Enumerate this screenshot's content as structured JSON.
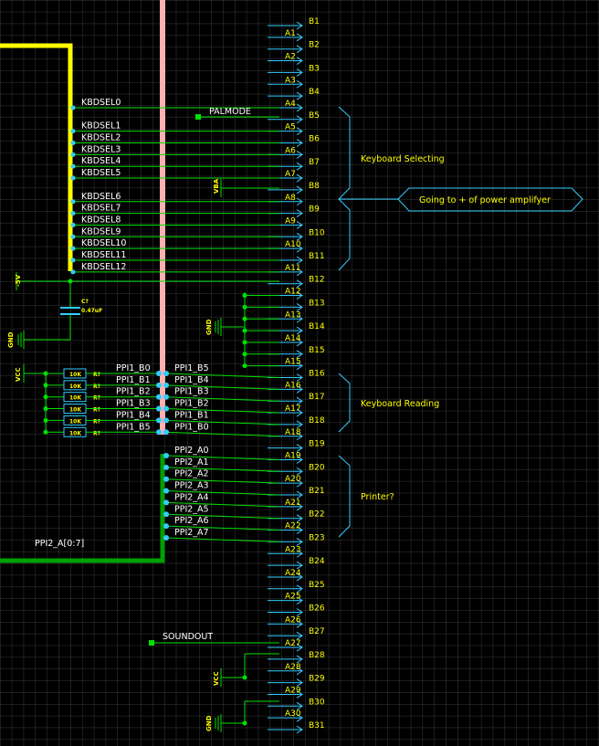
{
  "colors": {
    "background": "#000000",
    "grid": "#3a3a3a",
    "wire": "#00e000",
    "net_label": "#ffffff",
    "pin_label": "#ffff00",
    "connector": "#33ccff",
    "bus_yellow": "#ffff00",
    "bus_pink": "#ffb0b0",
    "bus_green": "#00a000",
    "junction": "#00e000",
    "power_label": "#ffff00",
    "annotation": "#ffff00"
  },
  "connector": {
    "pins": [
      "B1",
      "A1",
      "B2",
      "A2",
      "B3",
      "A3",
      "B4",
      "A4",
      "B5",
      "A5",
      "B6",
      "A6",
      "B7",
      "A7",
      "B8",
      "A8",
      "B9",
      "A9",
      "B10",
      "A10",
      "B11",
      "A11",
      "B12",
      "A12",
      "B13",
      "A13",
      "B14",
      "A14",
      "B15",
      "A15",
      "B16",
      "A16",
      "B17",
      "A17",
      "B18",
      "A18",
      "B19",
      "A19",
      "B20",
      "A20",
      "B21",
      "A21",
      "B22",
      "A22",
      "B23",
      "A23",
      "B24",
      "A24",
      "B25",
      "A25",
      "B26",
      "A26",
      "B27",
      "A27",
      "B28",
      "A28",
      "B29",
      "A29",
      "B30",
      "A30",
      "B31"
    ]
  },
  "nets": {
    "kbdsel": [
      "KBDSEL0",
      "KBDSEL1",
      "KBDSEL2",
      "KBDSEL3",
      "KBDSEL4",
      "KBDSEL5",
      "KBDSEL6",
      "KBDSEL7",
      "KBDSEL8",
      "KBDSEL9",
      "KBDSEL10",
      "KBDSEL11",
      "KBDSEL12"
    ],
    "palmode": "PALMODE",
    "ppi1_left": [
      "PPI1_B0",
      "PPI1_B1",
      "PPI1_B2",
      "PPI1_B3",
      "PPI1_B4",
      "PPI1_B5"
    ],
    "ppi1_right": [
      "PPI1_B5",
      "PPI1_B4",
      "PPI1_B3",
      "PPI1_B2",
      "PPI1_B1",
      "PPI1_B0"
    ],
    "ppi2": [
      "PPI2_A0",
      "PPI2_A1",
      "PPI2_A2",
      "PPI2_A3",
      "PPI2_A4",
      "PPI2_A5",
      "PPI2_A6",
      "PPI2_A7"
    ],
    "ppi2_bus": "PPI2_A[0:7]",
    "soundout": "SOUNDOUT"
  },
  "power": {
    "vba": "VBA",
    "minus5v": "-5V",
    "gnd": "GND",
    "vcc": "VCC"
  },
  "capacitor": {
    "ref": "C?",
    "value": "0.47uF"
  },
  "resistors": {
    "value": "10K",
    "ref": "R?"
  },
  "annotations": {
    "keyboard_selecting": "Keyboard Selecting",
    "keyboard_reading": "Keyboard Reading",
    "printer": "Printer?",
    "power_amp": "Going to + of power amplifyer"
  }
}
